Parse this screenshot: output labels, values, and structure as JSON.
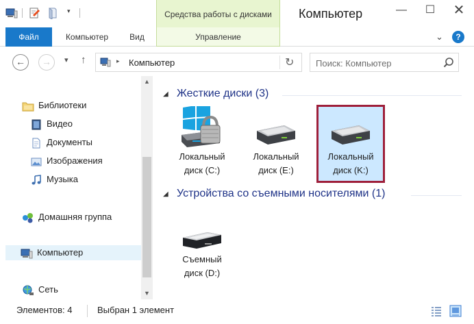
{
  "window": {
    "title": "Компьютер",
    "context_group": "Средства работы с дисками",
    "controls": {
      "minimize": "—",
      "maximize": "☐",
      "close": "✕"
    }
  },
  "ribbon": {
    "tabs": [
      {
        "label": "Файл"
      },
      {
        "label": "Компьютер"
      },
      {
        "label": "Вид"
      },
      {
        "label": "Управление"
      }
    ],
    "help": "?"
  },
  "navigation": {
    "back": "←",
    "forward": "→",
    "recent": "▾",
    "up": "↑"
  },
  "address": {
    "path": "Компьютер",
    "separator": "▸"
  },
  "search": {
    "placeholder": "Поиск: Компьютер"
  },
  "sidebar": {
    "items": [
      {
        "label": "Библиотеки",
        "icon": "libraries-icon"
      },
      {
        "label": "Видео",
        "icon": "video-library-icon"
      },
      {
        "label": "Документы",
        "icon": "documents-library-icon"
      },
      {
        "label": "Изображения",
        "icon": "pictures-library-icon"
      },
      {
        "label": "Музыка",
        "icon": "music-library-icon"
      },
      {
        "label": "Домашняя группа",
        "icon": "homegroup-icon"
      },
      {
        "label": "Компьютер",
        "icon": "computer-icon",
        "selected": true
      },
      {
        "label": "Сеть",
        "icon": "network-icon"
      }
    ]
  },
  "content": {
    "groups": [
      {
        "title": "Жесткие диски (3)",
        "items": [
          {
            "line1": "Локальный",
            "line2": "диск (C:)",
            "icon": "system-drive-icon"
          },
          {
            "line1": "Локальный",
            "line2": "диск (E:)",
            "icon": "hard-drive-icon"
          },
          {
            "line1": "Локальный",
            "line2": "диск (K:)",
            "icon": "hard-drive-icon",
            "selected": true
          }
        ]
      },
      {
        "title": "Устройства со съемными носителями (1)",
        "items": [
          {
            "line1": "Съемный",
            "line2": "диск (D:)",
            "icon": "removable-drive-icon"
          }
        ]
      }
    ]
  },
  "status": {
    "count": "Элементов: 4",
    "selection": "Выбран 1 элемент"
  },
  "colors": {
    "accent": "#1979ca",
    "selection_fill": "#cce8ff",
    "selection_border": "#9e1f3a",
    "group_title": "#1e3287",
    "context_tab": "#e8f5d0"
  }
}
